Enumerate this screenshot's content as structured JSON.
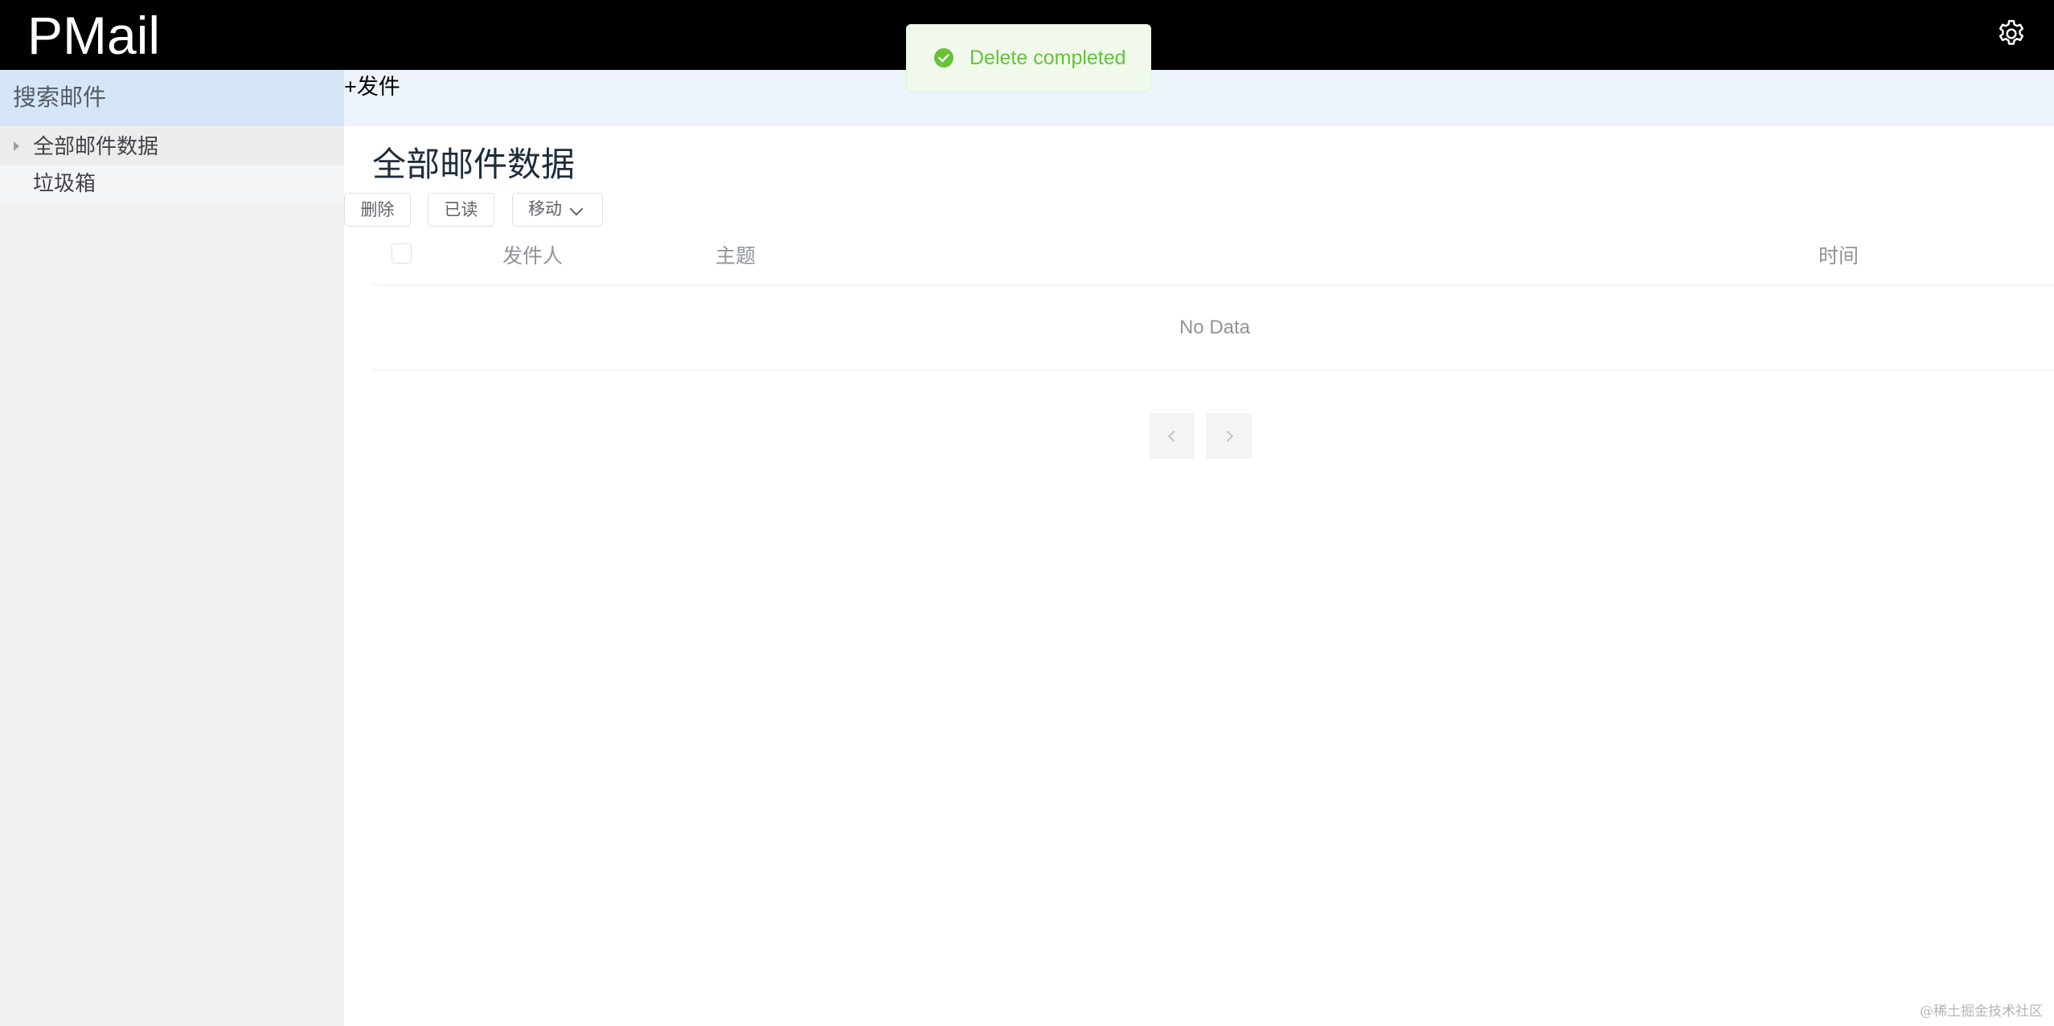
{
  "header": {
    "logo": "PMail",
    "settings_icon": "gear-icon"
  },
  "sidebar": {
    "search_label": "搜索邮件",
    "items": [
      {
        "label": "全部邮件数据",
        "has_caret": true
      },
      {
        "label": "垃圾箱",
        "has_caret": false
      }
    ]
  },
  "compose": {
    "label": "+发件"
  },
  "main": {
    "title": "全部邮件数据",
    "toolbar": {
      "delete_label": "删除",
      "read_label": "已读",
      "move_label": "移动"
    },
    "table": {
      "columns": [
        "发件人",
        "主题",
        "时间"
      ],
      "empty_text": "No Data"
    },
    "pagination": {
      "prev_icon": "chevron-left-icon",
      "next_icon": "chevron-right-icon"
    }
  },
  "toast": {
    "message": "Delete completed",
    "icon": "check-circle-icon",
    "color": "#67c23a"
  },
  "watermark": "@稀土掘金技术社区"
}
